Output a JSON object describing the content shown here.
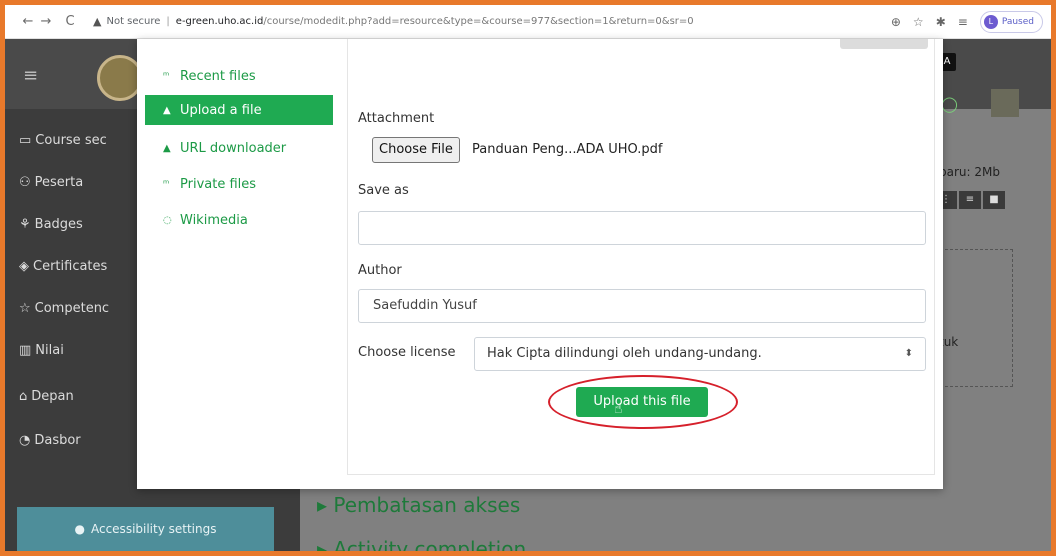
{
  "browser": {
    "security_label": "Not secure",
    "url_host": "e-green.uho.ac.id",
    "url_rest": "/course/modedit.php?add=resource&type=&course=977&section=1&return=0&sr=0",
    "profile_status": "Paused",
    "profile_initial": "L"
  },
  "sidebar": {
    "items": [
      {
        "label": "Course sec",
        "icon": "folder-icon"
      },
      {
        "label": "Peserta",
        "icon": "users-icon"
      },
      {
        "label": "Badges",
        "icon": "badge-icon"
      },
      {
        "label": "Certificates",
        "icon": "certificate-icon"
      },
      {
        "label": "Competenc",
        "icon": "star-icon"
      },
      {
        "label": "Nilai",
        "icon": "grades-icon"
      },
      {
        "label": "Depan",
        "icon": "home-icon"
      },
      {
        "label": "Dasbor",
        "icon": "dashboard-icon"
      }
    ],
    "accessibility": "Accessibility settings"
  },
  "background": {
    "badge": "A",
    "max_size_text": "baru: 2Mb",
    "peek_text": "tuk",
    "sections": [
      "Pembatasan akses",
      "Activity completion"
    ]
  },
  "filepicker": {
    "repositories": [
      {
        "label": "Recent files",
        "icon": "recent-files-icon",
        "active": false
      },
      {
        "label": "Upload a file",
        "icon": "upload-icon",
        "active": true
      },
      {
        "label": "URL downloader",
        "icon": "url-icon",
        "active": false
      },
      {
        "label": "Private files",
        "icon": "private-files-icon",
        "active": false
      },
      {
        "label": "Wikimedia",
        "icon": "wikimedia-icon",
        "active": false
      }
    ],
    "attachment_label": "Attachment",
    "choose_file_label": "Choose File",
    "chosen_file": "Panduan Peng...ADA UHO.pdf",
    "save_as_label": "Save as",
    "save_as_value": "",
    "author_label": "Author",
    "author_value": "Saefuddin Yusuf",
    "license_label": "Choose license",
    "license_value": "Hak Cipta dilindungi oleh undang-undang.",
    "upload_button": "Upload this file"
  },
  "colors": {
    "accent_green": "#1faa52",
    "highlight_red": "#d6202b",
    "frame_orange": "#e8792b"
  }
}
